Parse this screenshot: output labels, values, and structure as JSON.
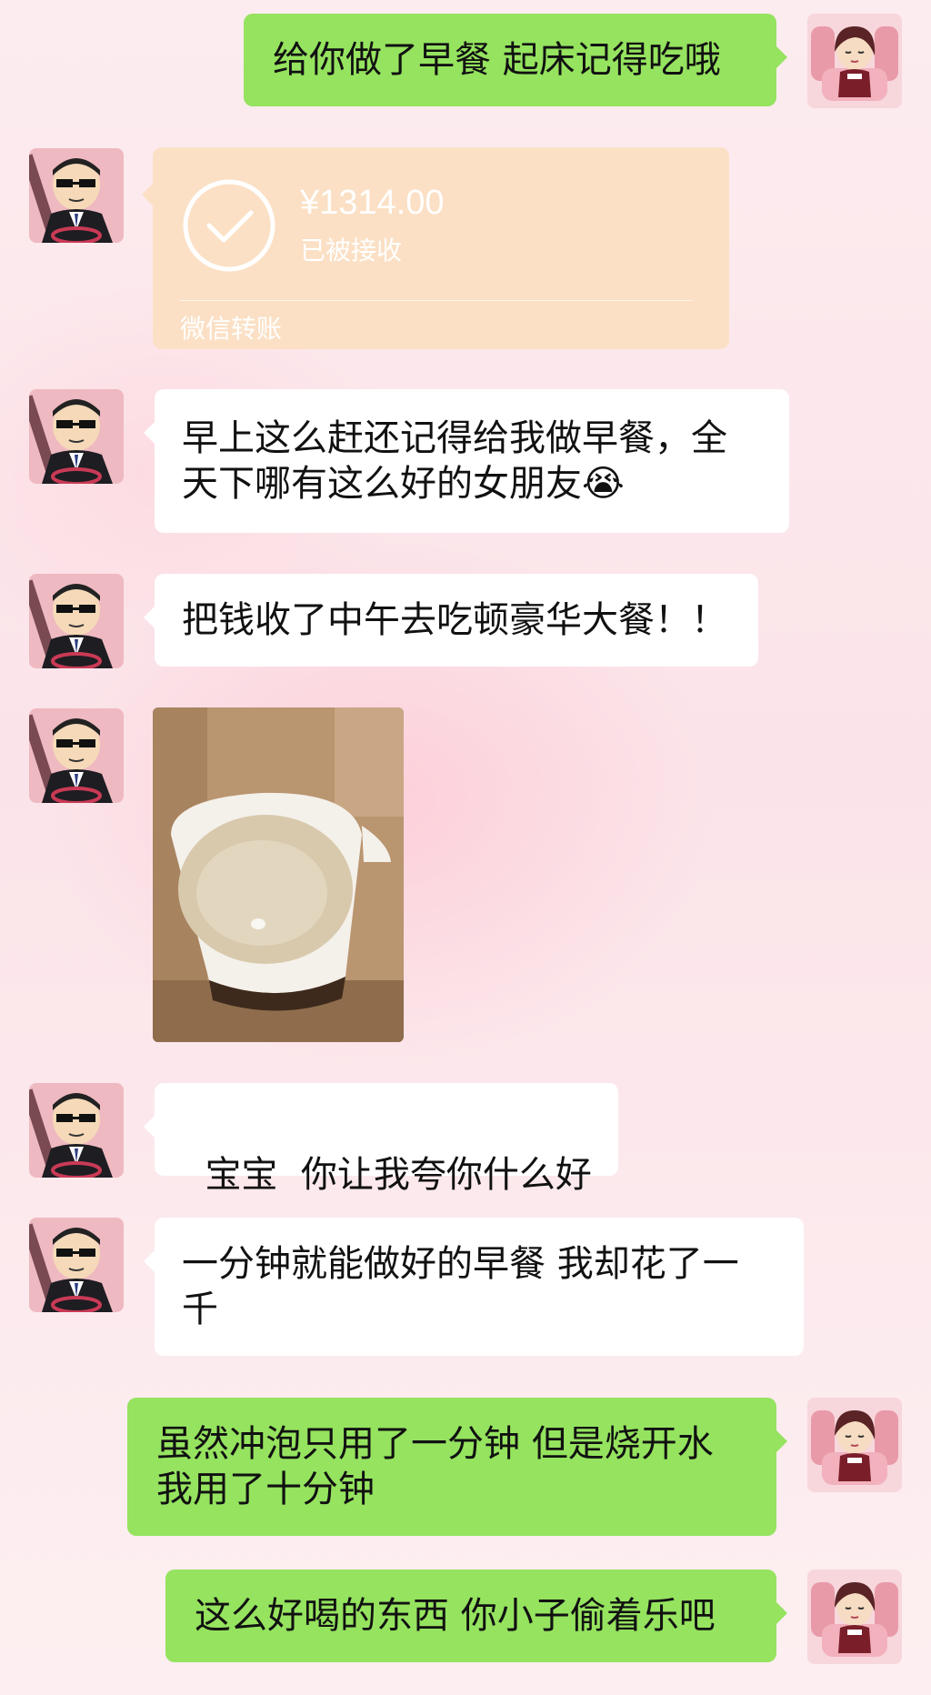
{
  "messages": {
    "m1": "给你做了早餐 起床记得吃哦",
    "transfer": {
      "amount": "¥1314.00",
      "status": "已被接收",
      "label": "微信转账"
    },
    "m3_line1": "早上这么赶还记得给我做早餐，全",
    "m3_line2": "天下哪有这么好的女朋友",
    "m3_emoji": "😭",
    "m4": "把钱收了中午去吃顿豪华大餐！！",
    "m6": "宝宝  你让我夸你什么好",
    "m7_line1": "一分钟就能做好的早餐 我却花了一",
    "m7_line2": "千",
    "m8_line1": "虽然冲泡只用了一分钟 但是烧开水",
    "m8_line2": "我用了十分钟",
    "m9": "这么好喝的东西 你小子偷着乐吧"
  },
  "colors": {
    "sent_bubble": "#95e35f",
    "received_bubble": "#ffffff",
    "transfer_card": "#fbe0c5"
  }
}
